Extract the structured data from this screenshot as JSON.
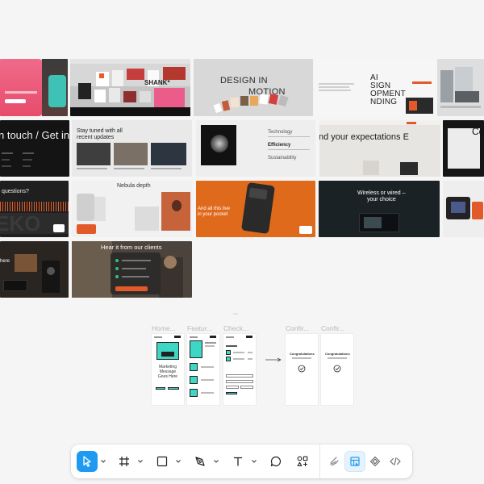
{
  "tiles": {
    "t1": {
      "label": ""
    },
    "t2": {
      "headline": "SHANK*"
    },
    "t3": {
      "line1": "DESIGN IN",
      "line2": "MOTION"
    },
    "t4": {
      "text": "AI SIGN OPMENT NDING",
      "line1": "AI",
      "line2": "SIGN",
      "line3": "OPMENT",
      "line4": "NDING"
    },
    "t5": {
      "text": ""
    },
    "t6": {
      "text": "n touch / Get in"
    },
    "t7": {
      "line1": "Stay tuned with all",
      "line2": "recent updates"
    },
    "t8": {
      "item1": "Technology",
      "item2": "Efficiency",
      "item3": "Sustainability"
    },
    "t9": {
      "text": "nd your expectations  E"
    },
    "t10": {
      "text": "Co"
    },
    "t11": {
      "text": "questions?"
    },
    "t12": {
      "text": "Nebula depth"
    },
    "t13": {
      "line1": "And all this live",
      "line2": "in your pocket"
    },
    "t14": {
      "line1": "Wireless or wired –",
      "line2": "your choice"
    },
    "t16": {
      "text": "here"
    },
    "t17": {
      "text": "Hear it from our clients"
    }
  },
  "frames": [
    {
      "title": "Home...",
      "mini_title": "Marketing Message Goes Here"
    },
    {
      "title": "Featur..."
    },
    {
      "title": "Check..."
    },
    {
      "title": "Confir...",
      "mini_title": "Congratulations"
    },
    {
      "title": "Confir...",
      "mini_title": "Congratulations"
    }
  ],
  "toolbar": {
    "tools": [
      {
        "name": "move-tool",
        "icon": "cursor-arrow-icon",
        "active": true
      },
      {
        "name": "frame-tool",
        "icon": "hash-frame-icon"
      },
      {
        "name": "shape-tool",
        "icon": "rectangle-icon"
      },
      {
        "name": "pen-tool",
        "icon": "pen-nib-icon"
      },
      {
        "name": "text-tool",
        "icon": "text-t-icon"
      },
      {
        "name": "comment-tool",
        "icon": "speech-bubble-icon"
      },
      {
        "name": "actions-tool",
        "icon": "shapes-plus-icon"
      }
    ],
    "modes": [
      {
        "name": "draw-mode",
        "icon": "draw-pencil-icon"
      },
      {
        "name": "design-mode",
        "icon": "design-layout-icon",
        "active": true
      },
      {
        "name": "component-mode",
        "icon": "diamond-icon"
      },
      {
        "name": "dev-mode",
        "icon": "code-brackets-icon"
      }
    ],
    "accent": "#1e9bf0"
  }
}
